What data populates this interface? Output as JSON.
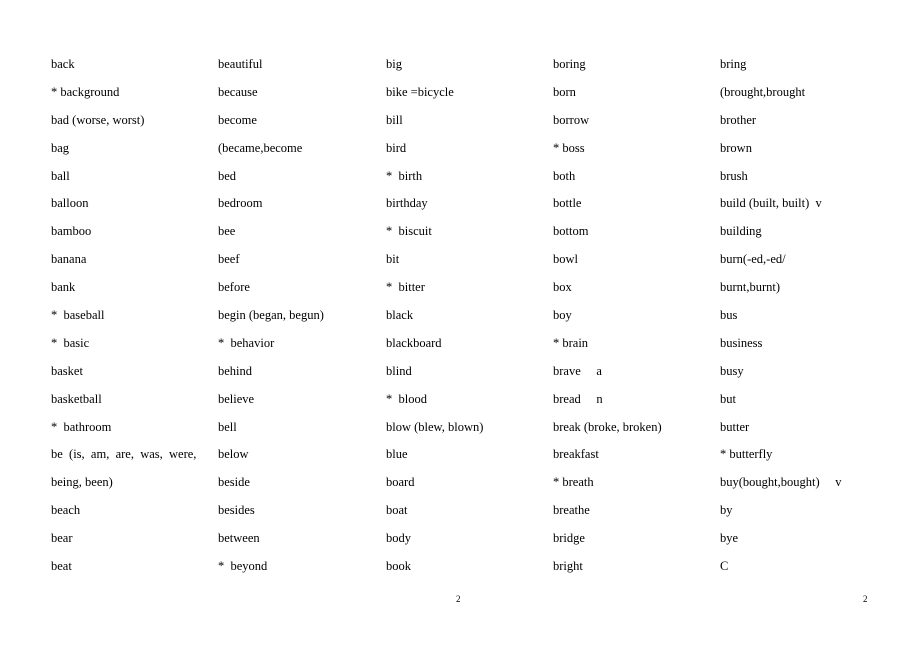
{
  "columns": [
    [
      "back",
      "* background",
      "bad (worse, worst)",
      "bag",
      "ball",
      "balloon",
      "bamboo",
      "banana",
      "bank",
      "*  baseball",
      "*  basic",
      "basket",
      "basketball",
      "*  bathroom",
      "be  (is,  am,  are,  was,  were,",
      "being, been)",
      "beach",
      "bear",
      "beat"
    ],
    [
      "beautiful",
      "because",
      "become",
      "(became,become",
      "bed",
      "bedroom",
      "bee",
      "beef",
      "before",
      "begin (began, begun)",
      "*  behavior",
      "behind",
      "believe",
      "bell",
      "below",
      "beside",
      "besides",
      "between",
      "*  beyond"
    ],
    [
      "big",
      "bike =bicycle",
      "bill",
      "bird",
      "*  birth",
      "birthday",
      "*  biscuit",
      "bit",
      "*  bitter",
      "black",
      "blackboard",
      "blind",
      "*  blood",
      "blow (blew, blown)",
      "blue",
      "board",
      "boat",
      "body",
      "book"
    ],
    [
      "boring",
      "born",
      "borrow",
      "* boss",
      "both",
      "bottle",
      "bottom",
      "bowl",
      "box",
      "boy",
      "* brain",
      "brave     a",
      "bread     n",
      "break (broke, broken)",
      "breakfast",
      "* breath",
      "breathe",
      "bridge",
      "bright"
    ],
    [
      "bring",
      "(brought,brought",
      "brother",
      "brown",
      "brush",
      "build (built, built)  v",
      "building",
      "burn(-ed,-ed/",
      "burnt,burnt)",
      "bus",
      "business",
      "busy",
      "but",
      "butter",
      "* butterfly",
      "buy(bought,bought)     v",
      "by",
      "bye",
      "C"
    ]
  ],
  "page_numbers": [
    "2",
    "2"
  ]
}
